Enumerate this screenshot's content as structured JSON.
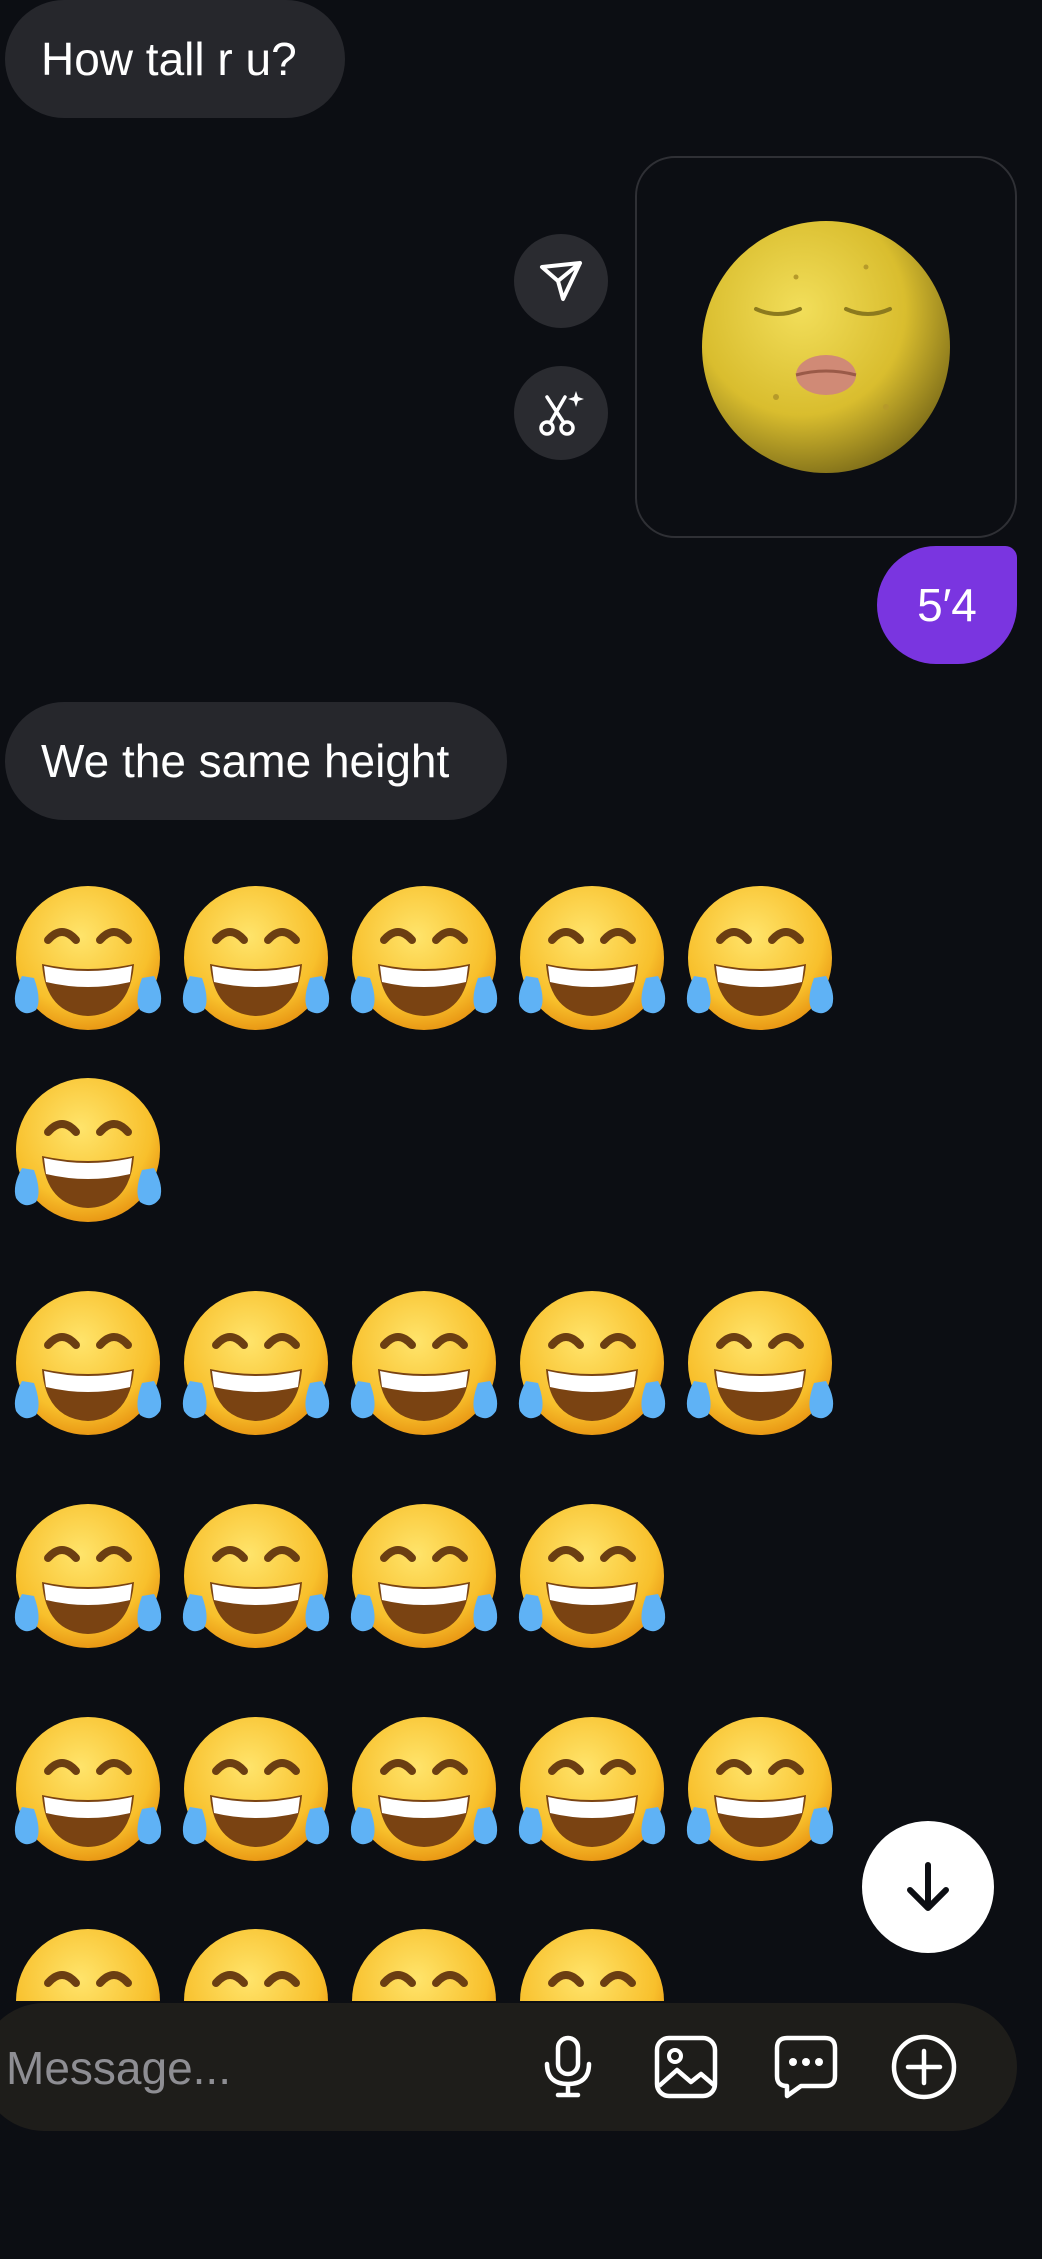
{
  "messages": {
    "incoming_1": "How tall r u?",
    "outgoing_1": "5′4",
    "incoming_2": "We the same height"
  },
  "emoji": {
    "glyph": "😂",
    "rows": [
      5,
      1,
      5,
      4,
      5,
      4
    ]
  },
  "sticker": {
    "icon": "lemon-face-sticker"
  },
  "sticker_actions": {
    "send_icon": "send-icon",
    "remix_icon": "cut-sparkle-icon"
  },
  "composer": {
    "placeholder": "Message...",
    "icons": [
      "microphone-icon",
      "image-icon",
      "chat-bubble-icon",
      "plus-circle-icon"
    ]
  },
  "colors": {
    "background": "#0c0e13",
    "incoming_bubble": "#26272c",
    "outgoing_bubble": "#7a35e0",
    "composer": "#1e1d1a"
  }
}
